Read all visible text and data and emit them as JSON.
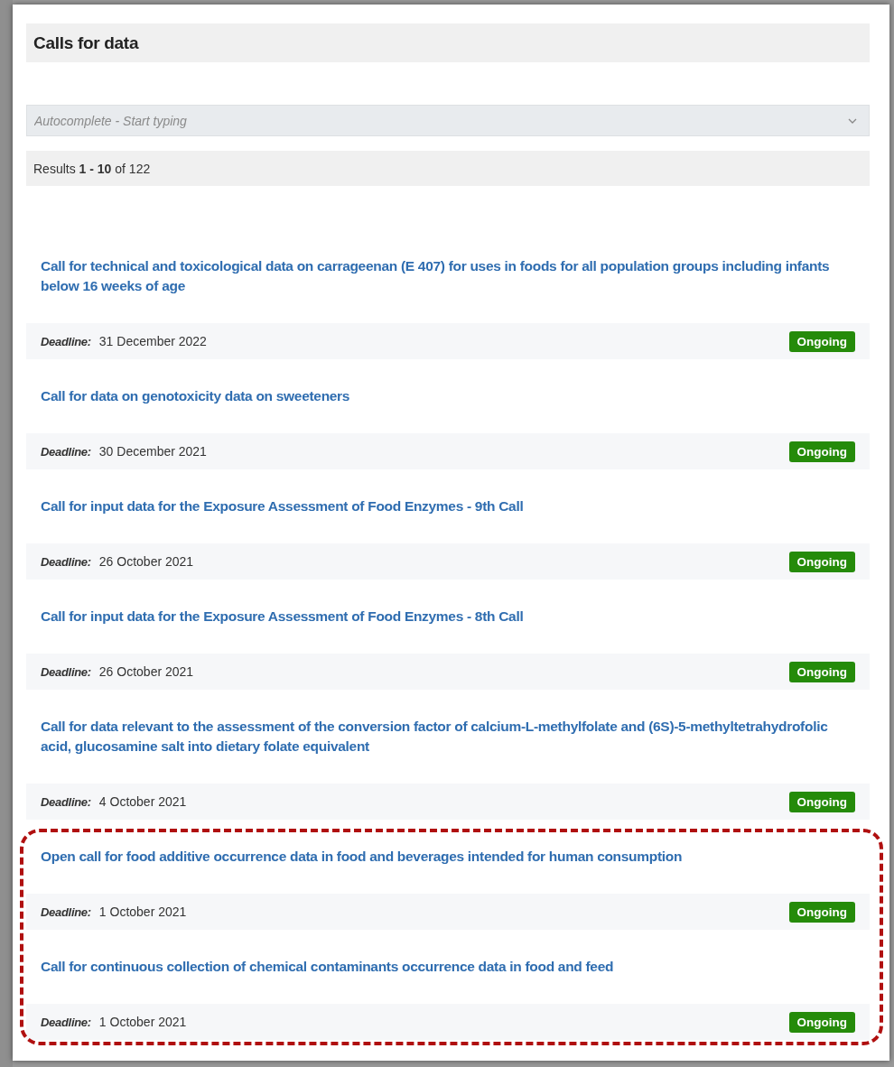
{
  "title": "Calls for data",
  "search": {
    "placeholder": "Autocomplete - Start typing"
  },
  "results": "Results **1 - 10** of 122",
  "items": [
    {
      "title": "Call for technical and toxicological data on carrageenan (E 407) for uses in foods for all population groups including infants below 16 weeks of age",
      "deadline_label": "Deadline:",
      "deadline": "31 December 2022",
      "status": "Ongoing",
      "highlighted": false
    },
    {
      "title": "Call for data on genotoxicity data on sweeteners",
      "deadline_label": "Deadline:",
      "deadline": "30 December 2021",
      "status": "Ongoing",
      "highlighted": false
    },
    {
      "title": "Call for input data for the Exposure Assessment of Food Enzymes - 9th Call",
      "deadline_label": "Deadline:",
      "deadline": "26 October 2021",
      "status": "Ongoing",
      "highlighted": false
    },
    {
      "title": "Call for input data for the Exposure Assessment of Food Enzymes - 8th Call",
      "deadline_label": "Deadline:",
      "deadline": "26 October 2021",
      "status": "Ongoing",
      "highlighted": false
    },
    {
      "title": "Call for data relevant to the assessment of the conversion factor of calcium-L-methylfolate and (6S)-5-methyltetrahydrofolic acid, glucosamine salt into dietary folate equivalent",
      "deadline_label": "Deadline:",
      "deadline": "4 October 2021",
      "status": "Ongoing",
      "highlighted": false
    },
    {
      "title": "Open call for food additive occurrence data in food and beverages intended for human consumption",
      "deadline_label": "Deadline:",
      "deadline": "1 October 2021",
      "status": "Ongoing",
      "highlighted": true
    },
    {
      "title": "Call for continuous collection of chemical contaminants occurrence data in food and feed",
      "deadline_label": "Deadline:",
      "deadline": "1 October 2021",
      "status": "Ongoing",
      "highlighted": true
    }
  ]
}
